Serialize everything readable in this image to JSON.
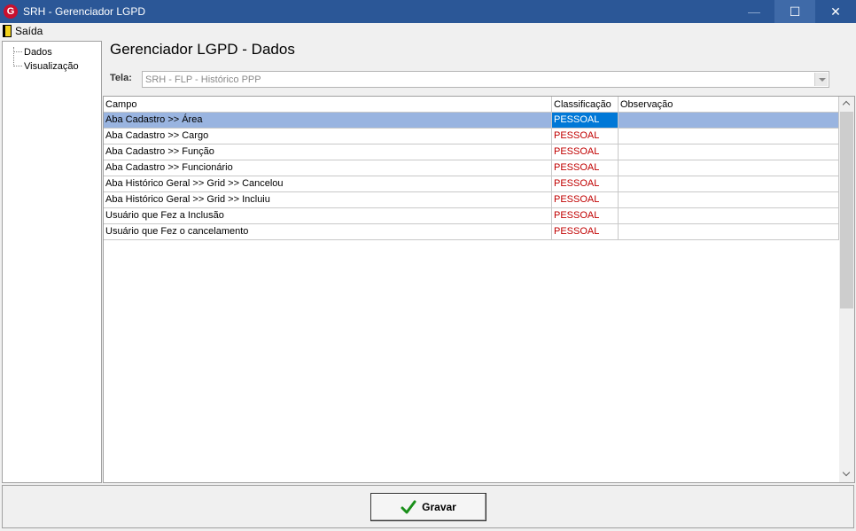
{
  "window": {
    "title": "SRH - Gerenciador LGPD",
    "icon_letter": "G"
  },
  "titlebar_buttons": {
    "minimize": "—",
    "maximize": "☐",
    "close": "✕"
  },
  "menu": {
    "exit_label": "Saída"
  },
  "tree": {
    "items": [
      {
        "label": "Dados"
      },
      {
        "label": "Visualização"
      }
    ]
  },
  "page": {
    "title": "Gerenciador LGPD - Dados",
    "tela_label": "Tela:",
    "tela_value": "SRH - FLP - Histórico PPP"
  },
  "grid": {
    "columns": [
      "Campo",
      "Classificação",
      "Observação"
    ],
    "rows": [
      {
        "campo": "Aba Cadastro >> Área",
        "classificacao": "PESSOAL",
        "observacao": ""
      },
      {
        "campo": "Aba Cadastro >> Cargo",
        "classificacao": "PESSOAL",
        "observacao": ""
      },
      {
        "campo": "Aba Cadastro >> Função",
        "classificacao": "PESSOAL",
        "observacao": ""
      },
      {
        "campo": "Aba Cadastro >> Funcionário",
        "classificacao": "PESSOAL",
        "observacao": ""
      },
      {
        "campo": "Aba Histórico Geral >> Grid >> Cancelou",
        "classificacao": "PESSOAL",
        "observacao": ""
      },
      {
        "campo": "Aba Histórico Geral >> Grid >> Incluiu",
        "classificacao": "PESSOAL",
        "observacao": ""
      },
      {
        "campo": "Usuário que Fez a Inclusão",
        "classificacao": "PESSOAL",
        "observacao": ""
      },
      {
        "campo": "Usuário que Fez o cancelamento",
        "classificacao": "PESSOAL",
        "observacao": ""
      }
    ],
    "selected_row": 0
  },
  "footer": {
    "save_label": "Gravar"
  },
  "colors": {
    "titlebar": "#2b5797",
    "selection": "#0078d7",
    "classification_text": "#c00000",
    "check": "#1a8f1a"
  }
}
